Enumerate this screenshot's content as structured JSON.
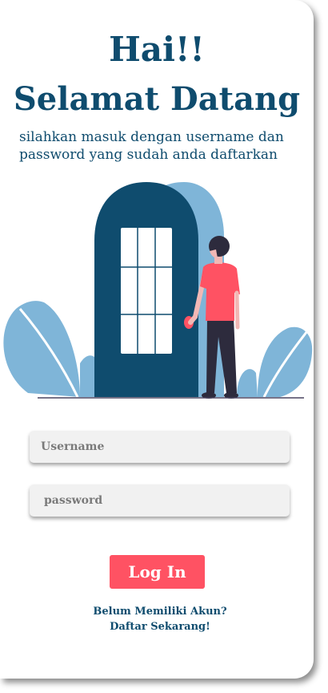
{
  "header": {
    "greeting": "Hai!!",
    "welcome": "Selamat Datang",
    "subtitle": "silahkan masuk dengan username dan password yang sudah anda daftarkan"
  },
  "illustration": {
    "icon": "person-at-door-illustration",
    "colors": {
      "door": "#0f4c6e",
      "door_back": "#7fb5d8",
      "leaves": "#7fb5d8",
      "shirt": "#ff5263",
      "pants": "#2d2b3d",
      "hair": "#2d2b3d"
    }
  },
  "form": {
    "username_placeholder": "Username",
    "username_value": "",
    "password_placeholder": "password",
    "password_value": "",
    "login_label": "Log In"
  },
  "register": {
    "question": "Belum Memiliki Akun?",
    "link": "Daftar Sekarang!"
  },
  "colors": {
    "primary": "#0f4c6e",
    "accent": "#ff5263",
    "input_bg": "#f1f1f1"
  }
}
